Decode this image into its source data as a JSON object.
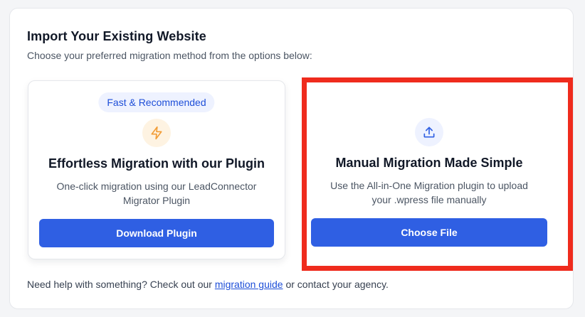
{
  "header": {
    "title": "Import Your Existing Website",
    "subtitle": "Choose your preferred migration method from the options below:"
  },
  "plugin_card": {
    "badge": "Fast & Recommended",
    "icon": "lightning-bolt-icon",
    "title": "Effortless Migration with our Plugin",
    "description_line1": "One-click migration using our LeadConnector",
    "description_line2": "Migrator Plugin",
    "button_label": "Download Plugin"
  },
  "manual_card": {
    "icon": "upload-icon",
    "title": "Manual Migration Made Simple",
    "description_line1": "Use the All-in-One Migration plugin to upload",
    "description_line2": "your .wpress file manually",
    "button_label": "Choose File",
    "highlighted": true
  },
  "footer": {
    "text_before": "Need help with something? Check out our ",
    "link_label": "migration guide",
    "text_after": " or contact your agency."
  },
  "colors": {
    "primary": "#2f5fe3",
    "highlight": "#ef2b1d",
    "badge_bg": "#eef2ff",
    "bolt": "#f29d38"
  }
}
